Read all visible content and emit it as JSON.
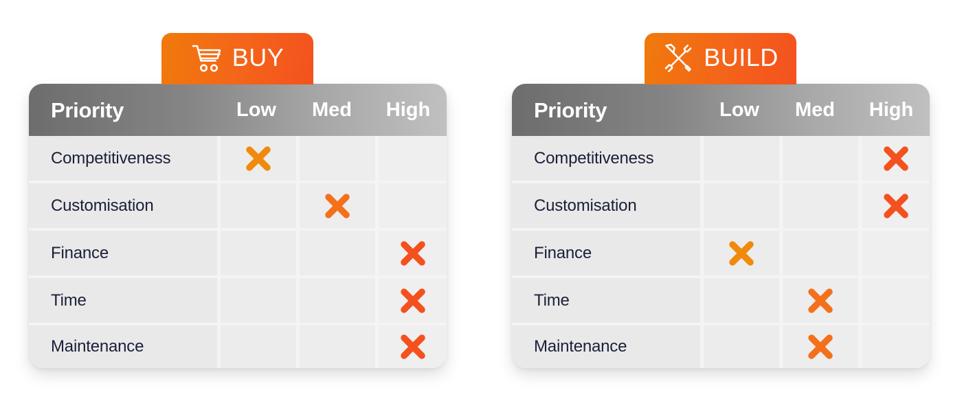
{
  "page": {
    "background": "#ffffff",
    "accent_orange": "#F4641A"
  },
  "columns": {
    "priority_header": "Priority",
    "levels": [
      "Low",
      "Med",
      "High"
    ]
  },
  "criteria": [
    "Competitiveness",
    "Customisation",
    "Finance",
    "Time",
    "Maintenance"
  ],
  "mark_colors": {
    "low": "#F08A0C",
    "med": "#F4701A",
    "high": "#F4511E"
  },
  "panels": [
    {
      "id": "buy",
      "tab_label": "BUY",
      "tab_icon": "shopping-cart-icon",
      "tab_gradient_from": "#F07A0C",
      "tab_gradient_to": "#F4511E",
      "header_gradient_from": "#6d6d6d",
      "header_gradient_to": "#c0c0c0",
      "rows": [
        {
          "label": "Competitiveness",
          "marks": [
            true,
            false,
            false
          ]
        },
        {
          "label": "Customisation",
          "marks": [
            false,
            true,
            false
          ]
        },
        {
          "label": "Finance",
          "marks": [
            false,
            false,
            true
          ]
        },
        {
          "label": "Time",
          "marks": [
            false,
            false,
            true
          ]
        },
        {
          "label": "Maintenance",
          "marks": [
            false,
            false,
            true
          ]
        }
      ]
    },
    {
      "id": "build",
      "tab_label": "BUILD",
      "tab_icon": "tools-screwdriver-wrench-icon",
      "tab_gradient_from": "#F07A0C",
      "tab_gradient_to": "#F4511E",
      "header_gradient_from": "#6d6d6d",
      "header_gradient_to": "#c0c0c0",
      "rows": [
        {
          "label": "Competitiveness",
          "marks": [
            false,
            false,
            true
          ]
        },
        {
          "label": "Customisation",
          "marks": [
            false,
            false,
            true
          ]
        },
        {
          "label": "Finance",
          "marks": [
            true,
            false,
            false
          ]
        },
        {
          "label": "Time",
          "marks": [
            false,
            true,
            false
          ]
        },
        {
          "label": "Maintenance",
          "marks": [
            false,
            true,
            false
          ]
        }
      ]
    }
  ]
}
